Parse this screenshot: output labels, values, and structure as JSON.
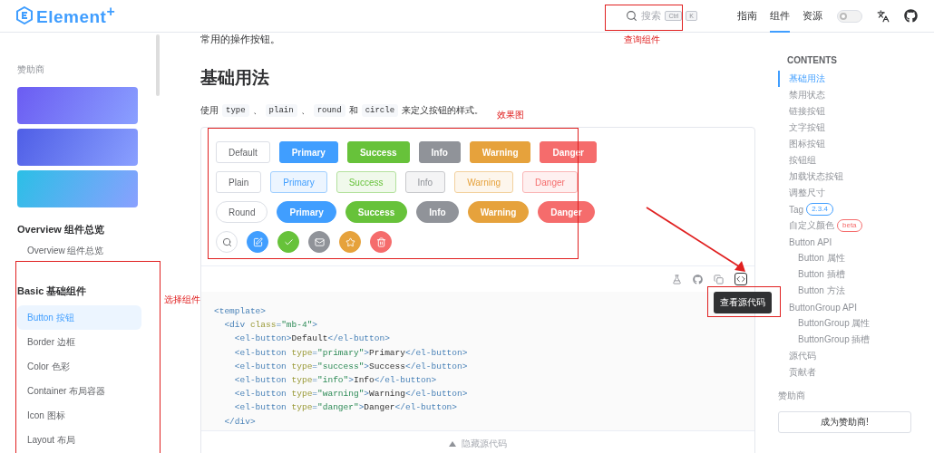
{
  "header": {
    "logo": "Element$^{+}$",
    "search": {
      "label": "搜索",
      "keys": [
        "Ctrl",
        "K"
      ]
    },
    "nav": [
      {
        "label": "指南",
        "selected": false
      },
      {
        "label": "组件",
        "selected": true
      },
      {
        "label": "资源",
        "selected": false
      }
    ],
    "theme_switch": {
      "on": false
    }
  },
  "sidebar": {
    "sponsor_title": "赞助商",
    "banners": [
      {
        "color": "#6b5cf2"
      },
      {
        "color": "#4f5ee6"
      },
      {
        "color": "#2bbfe6"
      }
    ],
    "groups": [
      {
        "title": "Overview 组件总览",
        "items": [
          {
            "label": "Overview 组件总览",
            "selected": false
          }
        ]
      },
      {
        "title": "Basic 基础组件",
        "items": [
          {
            "label": "Button 按钮",
            "selected": true
          },
          {
            "label": "Border 边框",
            "selected": false
          },
          {
            "label": "Color 色彩",
            "selected": false
          },
          {
            "label": "Container 布局容器",
            "selected": false
          },
          {
            "label": "Icon 图标",
            "selected": false
          },
          {
            "label": "Layout 布局",
            "selected": false
          }
        ]
      }
    ]
  },
  "main": {
    "intro": "常用的操作按钮。",
    "heading": "基础用法",
    "description": [
      {
        "kind": "text",
        "text": "使用"
      },
      {
        "kind": "code",
        "text": "type"
      },
      {
        "kind": "text",
        "text": "、"
      },
      {
        "kind": "code",
        "text": "plain"
      },
      {
        "kind": "text",
        "text": "、"
      },
      {
        "kind": "code",
        "text": "round"
      },
      {
        "kind": "text",
        "text": "和"
      },
      {
        "kind": "code",
        "text": "circle"
      },
      {
        "kind": "text",
        "text": "来定义按钮的样式。"
      }
    ],
    "demo": {
      "rows": [
        {
          "kind": "solid",
          "buttons": [
            {
              "kind": "default",
              "label": "Default"
            },
            {
              "kind": "primary",
              "label": "Primary"
            },
            {
              "kind": "success",
              "label": "Success"
            },
            {
              "kind": "info",
              "label": "Info"
            },
            {
              "kind": "warning",
              "label": "Warning"
            },
            {
              "kind": "danger",
              "label": "Danger"
            }
          ]
        },
        {
          "kind": "plain",
          "buttons": [
            {
              "kind": "default",
              "label": "Plain"
            },
            {
              "kind": "primary",
              "label": "Primary"
            },
            {
              "kind": "success",
              "label": "Success"
            },
            {
              "kind": "info",
              "label": "Info"
            },
            {
              "kind": "warning",
              "label": "Warning"
            },
            {
              "kind": "danger",
              "label": "Danger"
            }
          ]
        },
        {
          "kind": "round",
          "buttons": [
            {
              "kind": "default",
              "label": "Round"
            },
            {
              "kind": "primary",
              "label": "Primary"
            },
            {
              "kind": "success",
              "label": "Success"
            },
            {
              "kind": "info",
              "label": "Info"
            },
            {
              "kind": "warning",
              "label": "Warning"
            },
            {
              "kind": "danger",
              "label": "Danger"
            }
          ]
        },
        {
          "kind": "circle",
          "buttons": [
            {
              "kind": "default"
            },
            {
              "kind": "primary"
            },
            {
              "kind": "success"
            },
            {
              "kind": "info"
            },
            {
              "kind": "warning"
            },
            {
              "kind": "danger"
            }
          ]
        }
      ],
      "tooltip": "查看源代码",
      "code": [
        [
          {
            "kind": "tag",
            "text": "<template>"
          }
        ],
        [
          {
            "kind": "tag",
            "text": "  <div"
          },
          {
            "kind": "attr",
            "text": " class"
          },
          {
            "kind": "tag",
            "text": "="
          },
          {
            "kind": "str",
            "text": "\"mb-4\""
          },
          {
            "kind": "tag",
            "text": ">"
          }
        ],
        [
          {
            "kind": "tag",
            "text": "    <el-button>"
          },
          {
            "kind": "text",
            "text": "Default"
          },
          {
            "kind": "tag",
            "text": "</el-button>"
          }
        ],
        [
          {
            "kind": "tag",
            "text": "    <el-button"
          },
          {
            "kind": "attr",
            "text": " type"
          },
          {
            "kind": "tag",
            "text": "="
          },
          {
            "kind": "str",
            "text": "\"primary\""
          },
          {
            "kind": "tag",
            "text": ">"
          },
          {
            "kind": "text",
            "text": "Primary"
          },
          {
            "kind": "tag",
            "text": "</el-button>"
          }
        ],
        [
          {
            "kind": "tag",
            "text": "    <el-button"
          },
          {
            "kind": "attr",
            "text": " type"
          },
          {
            "kind": "tag",
            "text": "="
          },
          {
            "kind": "str",
            "text": "\"success\""
          },
          {
            "kind": "tag",
            "text": ">"
          },
          {
            "kind": "text",
            "text": "Success"
          },
          {
            "kind": "tag",
            "text": "</el-button>"
          }
        ],
        [
          {
            "kind": "tag",
            "text": "    <el-button"
          },
          {
            "kind": "attr",
            "text": " type"
          },
          {
            "kind": "tag",
            "text": "="
          },
          {
            "kind": "str",
            "text": "\"info\""
          },
          {
            "kind": "tag",
            "text": ">"
          },
          {
            "kind": "text",
            "text": "Info"
          },
          {
            "kind": "tag",
            "text": "</el-button>"
          }
        ],
        [
          {
            "kind": "tag",
            "text": "    <el-button"
          },
          {
            "kind": "attr",
            "text": " type"
          },
          {
            "kind": "tag",
            "text": "="
          },
          {
            "kind": "str",
            "text": "\"warning\""
          },
          {
            "kind": "tag",
            "text": ">"
          },
          {
            "kind": "text",
            "text": "Warning"
          },
          {
            "kind": "tag",
            "text": "</el-button>"
          }
        ],
        [
          {
            "kind": "tag",
            "text": "    <el-button"
          },
          {
            "kind": "attr",
            "text": " type"
          },
          {
            "kind": "tag",
            "text": "="
          },
          {
            "kind": "str",
            "text": "\"danger\""
          },
          {
            "kind": "tag",
            "text": ">"
          },
          {
            "kind": "text",
            "text": "Danger"
          },
          {
            "kind": "tag",
            "text": "</el-button>"
          }
        ],
        [
          {
            "kind": "tag",
            "text": "  </div>"
          }
        ]
      ],
      "hide_label": "隐藏源代码"
    }
  },
  "toc": {
    "title": "CONTENTS",
    "items": [
      {
        "label": "基础用法",
        "selected": true
      },
      {
        "label": "禁用状态",
        "selected": false
      },
      {
        "label": "链接按钮",
        "selected": false
      },
      {
        "label": "文字按钮",
        "selected": false
      },
      {
        "label": "图标按钮",
        "selected": false
      },
      {
        "label": "按钮组",
        "selected": false
      },
      {
        "label": "加载状态按钮",
        "selected": false
      },
      {
        "label": "调整尺寸",
        "selected": false
      },
      {
        "label": "Tag",
        "selected": false,
        "badge": {
          "text": "2.3.4",
          "color": "#409eff"
        }
      },
      {
        "label": "自定义颜色",
        "selected": false,
        "badge": {
          "text": "beta",
          "color": "#f56c6c"
        }
      },
      {
        "label": "Button API",
        "selected": false,
        "children": [
          {
            "label": "Button 属性",
            "selected": false
          },
          {
            "label": "Button 插槽",
            "selected": false
          },
          {
            "label": "Button 方法",
            "selected": false
          }
        ]
      },
      {
        "label": "ButtonGroup API",
        "selected": false,
        "children": [
          {
            "label": "ButtonGroup 属性",
            "selected": false
          },
          {
            "label": "ButtonGroup 插槽",
            "selected": false
          }
        ]
      },
      {
        "label": "源代码",
        "selected": false
      },
      {
        "label": "贡献者",
        "selected": false
      }
    ],
    "sponsor_title": "赞助商",
    "sponsor_button": "成为赞助商!"
  },
  "annotations": [
    {
      "kind": "box"
    },
    {
      "kind": "label",
      "text": "查询组件"
    },
    {
      "kind": "box"
    },
    {
      "kind": "label",
      "text": "效果图"
    },
    {
      "kind": "box"
    },
    {
      "kind": "label",
      "text": "选择组件"
    },
    {
      "kind": "arrow"
    },
    {
      "kind": "box"
    }
  ]
}
